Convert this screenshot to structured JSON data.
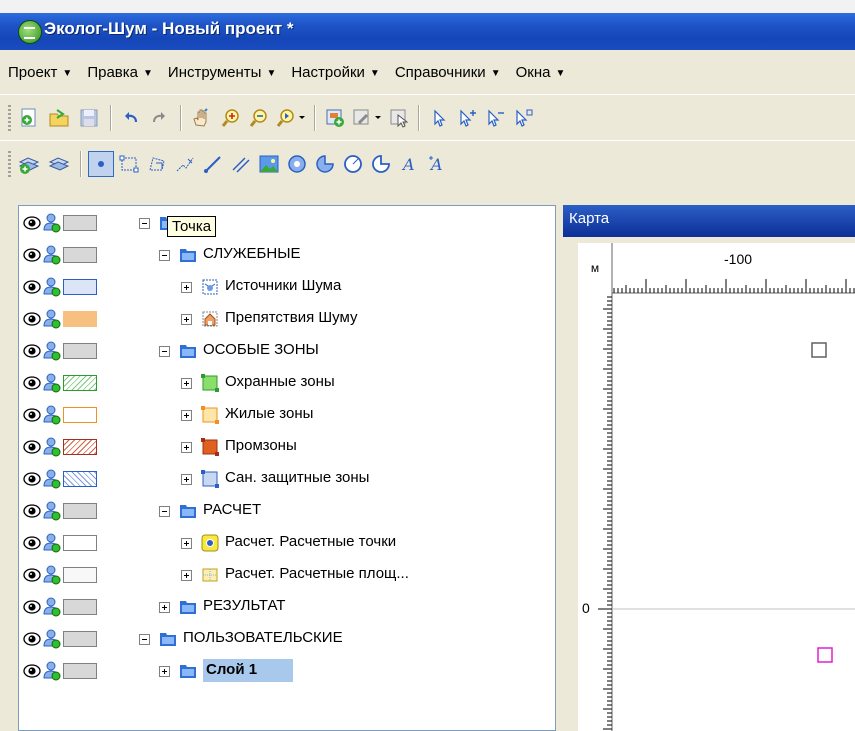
{
  "window": {
    "title": "Эколог-Шум - Новый проект *"
  },
  "menu": [
    {
      "label": "Проект"
    },
    {
      "label": "Правка"
    },
    {
      "label": "Инструменты"
    },
    {
      "label": "Настройки"
    },
    {
      "label": "Справочники"
    },
    {
      "label": "Окна"
    }
  ],
  "tooltip": "Точка",
  "layers": [
    {
      "label": "",
      "swatch": "#d8d8d8",
      "indent": 0,
      "expanded": true,
      "icon": "folder-icon"
    },
    {
      "label": "СЛУЖЕБНЫЕ",
      "swatch": "#d8d8d8",
      "indent": 1,
      "expanded": true,
      "icon": "folder-icon"
    },
    {
      "label": "Источники Шума",
      "swatch": "#dce4f8",
      "indent": 2,
      "expanded": false,
      "icon": "noise-source-icon"
    },
    {
      "label": "Препятствия Шуму",
      "swatch": "#f8c080",
      "indent": 2,
      "expanded": false,
      "icon": "house-icon"
    },
    {
      "label": "ОСОБЫЕ ЗОНЫ",
      "swatch": "#d8d8d8",
      "indent": 1,
      "expanded": true,
      "icon": "folder-icon"
    },
    {
      "label": "Охранные зоны",
      "swatch": "hatch-green",
      "indent": 2,
      "expanded": false,
      "icon": "green-zone-icon"
    },
    {
      "label": "Жилые зоны",
      "swatch": "#ffffff-orange",
      "indent": 2,
      "expanded": false,
      "icon": "orange-zone-icon"
    },
    {
      "label": "Промзоны",
      "swatch": "hatch-red",
      "indent": 2,
      "expanded": false,
      "icon": "red-zone-icon"
    },
    {
      "label": "Сан. защитные зоны",
      "swatch": "hatch-blue",
      "indent": 2,
      "expanded": false,
      "icon": "blue-zone-icon"
    },
    {
      "label": "РАСЧЕТ",
      "swatch": "#d8d8d8",
      "indent": 1,
      "expanded": true,
      "icon": "folder-icon"
    },
    {
      "label": "Расчет. Расчетные точки",
      "swatch": "#ffffff",
      "indent": 2,
      "expanded": false,
      "icon": "calc-point-icon"
    },
    {
      "label": "Расчет. Расчетные площ...",
      "swatch": "#f8f8f8",
      "indent": 2,
      "expanded": false,
      "icon": "calc-area-icon"
    },
    {
      "label": "РЕЗУЛЬТАТ",
      "swatch": "#d8d8d8",
      "indent": 1,
      "expanded": false,
      "icon": "folder-icon"
    },
    {
      "label": "ПОЛЬЗОВАТЕЛЬСКИЕ",
      "swatch": "#d8d8d8",
      "indent": 0,
      "expanded": true,
      "icon": "folder-icon"
    },
    {
      "label": "Слой 1",
      "swatch": "#d8d8d8",
      "indent": 1,
      "expanded": false,
      "icon": "folder-icon",
      "selected": true
    }
  ],
  "map": {
    "title": "Карта",
    "unit": "м",
    "x_tick_label": "-100",
    "y_tick_label": "0"
  },
  "colors": {
    "title_bar": "#1546b8",
    "chrome": "#ece9d8",
    "selection": "#a8c8ec",
    "folder": "#2f6fd6"
  }
}
